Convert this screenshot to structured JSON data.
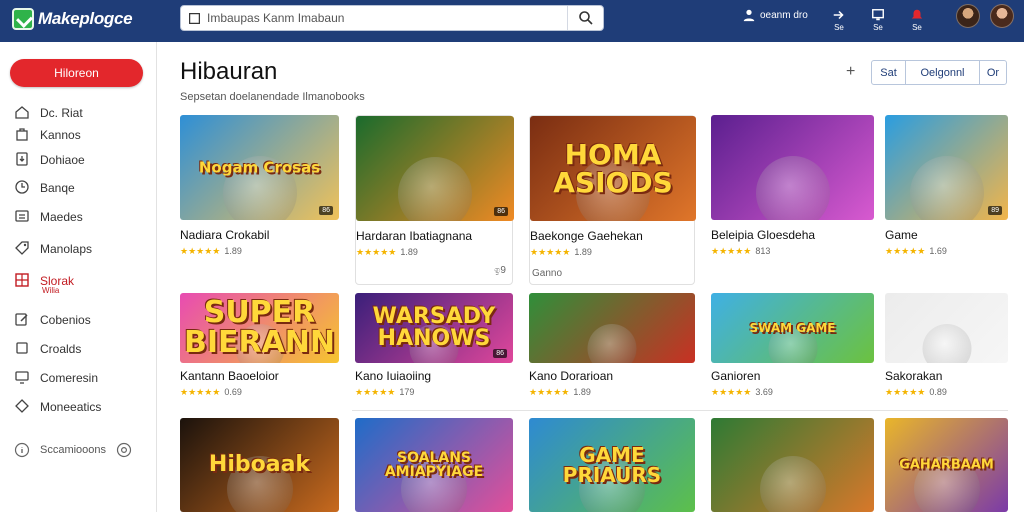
{
  "app": {
    "name": "Makeplogce"
  },
  "header": {
    "search_value": "Imbaupas Kanm Imabaun",
    "actions": [
      {
        "icon": "user-icon",
        "label": "oeanm dro"
      },
      {
        "icon": "arrow-icon",
        "label": "Se"
      },
      {
        "icon": "monitor-icon",
        "label": "Se"
      },
      {
        "icon": "bell-icon",
        "label": "Se"
      }
    ]
  },
  "sidebar": {
    "primary_button": "Hiloreon",
    "items": [
      {
        "icon": "home-icon",
        "label": "Dc.   Riat"
      },
      {
        "icon": "bag-icon",
        "label": "Kannos"
      },
      {
        "icon": "download-icon",
        "label": "Dohiaoe"
      },
      {
        "icon": "clock-icon",
        "label": "Banqe"
      },
      {
        "icon": "list-icon",
        "label": "Maedes"
      },
      {
        "icon": "tag-icon",
        "label": "Manolaps"
      },
      {
        "icon": "grid-icon",
        "label": "Slorak",
        "sub": "Wilia"
      },
      {
        "icon": "edit-icon",
        "label": "Cobenios"
      },
      {
        "icon": "square-icon",
        "label": "Croalds"
      },
      {
        "icon": "monitor-icon",
        "label": "Comeresin"
      },
      {
        "icon": "diamond-icon",
        "label": "Moneeatics"
      }
    ],
    "footer": "Sccamiooons"
  },
  "main": {
    "title": "Hibauran",
    "subtitle": "Sepsetan doelanendade Ilmanobooks",
    "segments": [
      "Sat",
      "Oelgonnl",
      "Or"
    ],
    "cards": [
      {
        "title": "Nadiara Crokabil",
        "rating": "1.89",
        "stars": "★★★★★",
        "badge": "86",
        "art": "Nogam Crosas",
        "colors": [
          "#2e8fd6",
          "#f0c25a"
        ]
      },
      {
        "title": "Hardaran Ibatiagnana",
        "rating": "1.89",
        "stars": "★★★★★",
        "badge": "86",
        "art": "",
        "extra": "ඉ9",
        "colors": [
          "#1a6b2c",
          "#f08a24"
        ]
      },
      {
        "title": "Baekonge Gaehekan",
        "rating": "1.89",
        "stars": "★★★★★",
        "badge": "",
        "art": "HOMA ASIODS",
        "extra": "Ganno",
        "colors": [
          "#7a2d12",
          "#e0762a"
        ]
      },
      {
        "title": "Beleipia Gloesdeha",
        "rating": "813",
        "stars": "★★★★★",
        "badge": "",
        "art": "",
        "colors": [
          "#5b1f8f",
          "#d85ad0"
        ]
      },
      {
        "title": "Game",
        "rating": "1.69",
        "stars": "★★★★★",
        "badge": "89",
        "art": "",
        "colors": [
          "#2a9de0",
          "#f2b54a"
        ]
      },
      {
        "title": "Kantann Baoeloior",
        "rating": "0.69",
        "stars": "★★★★★",
        "badge": "",
        "art": "SUPER BIERANN",
        "colors": [
          "#e84bb2",
          "#f6c52e"
        ]
      },
      {
        "title": "Kano Iuiaoiing",
        "rating": "179",
        "stars": "★★★★★",
        "badge": "86",
        "art": "WARSADY HANOWS",
        "colors": [
          "#3a1f7a",
          "#e0479b"
        ]
      },
      {
        "title": "Kano Dorarioan",
        "rating": "1.89",
        "stars": "★★★★★",
        "badge": "",
        "art": "",
        "colors": [
          "#2f8f3a",
          "#c93023"
        ]
      },
      {
        "title": "Ganioren",
        "rating": "3.69",
        "stars": "★★★★★",
        "badge": "",
        "art": "SWAM GAME",
        "colors": [
          "#3fb0e4",
          "#6cc23f"
        ]
      },
      {
        "title": "Sakorakan",
        "rating": "0.89",
        "stars": "★★★★★",
        "badge": "",
        "art": "",
        "colors": [
          "#ececec",
          "#f6f6f6"
        ]
      },
      {
        "title": "",
        "rating": "",
        "stars": "",
        "badge": "",
        "art": "Hiboaak",
        "colors": [
          "#1b120c",
          "#c86a1e"
        ]
      },
      {
        "title": "",
        "rating": "",
        "stars": "",
        "badge": "",
        "art": "SOALANS AMIAPYIAGE",
        "colors": [
          "#1f6cc8",
          "#e24f9a"
        ]
      },
      {
        "title": "",
        "rating": "",
        "stars": "",
        "badge": "",
        "art": "GAME PRIAURS",
        "colors": [
          "#2e8ad2",
          "#5dc04a"
        ]
      },
      {
        "title": "",
        "rating": "",
        "stars": "",
        "badge": "",
        "art": "",
        "colors": [
          "#2e7a34",
          "#d8782a"
        ]
      },
      {
        "title": "",
        "rating": "",
        "stars": "",
        "badge": "",
        "art": "GAHARBAAM",
        "colors": [
          "#e9b62a",
          "#7b3aa8"
        ]
      }
    ]
  }
}
